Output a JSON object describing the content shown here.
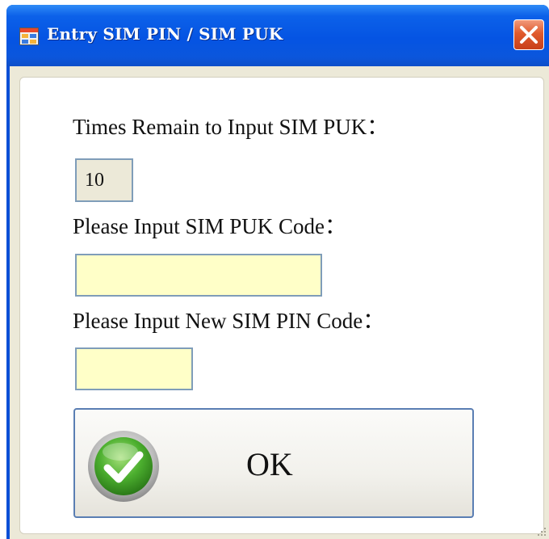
{
  "window": {
    "title": "Entry SIM PIN / SIM PUK"
  },
  "form": {
    "times_remain_label": "Times Remain to Input SIM PUK：",
    "times_remain_value": "10",
    "puk_label": "Please Input SIM PUK Code：",
    "puk_value": "",
    "new_pin_label": "Please Input New SIM PIN Code：",
    "new_pin_value": ""
  },
  "buttons": {
    "ok_label": "OK"
  },
  "icons": {
    "app": "application-window-icon",
    "close": "close-icon",
    "ok": "green-checkmark-icon",
    "grip": "resize-grip-icon"
  },
  "colors": {
    "title_bar": "#0554e3",
    "close_button": "#e05a2c",
    "input_background": "#ffffc8",
    "readonly_background": "#ece9d8",
    "checkmark_green": "#4caf2f"
  }
}
